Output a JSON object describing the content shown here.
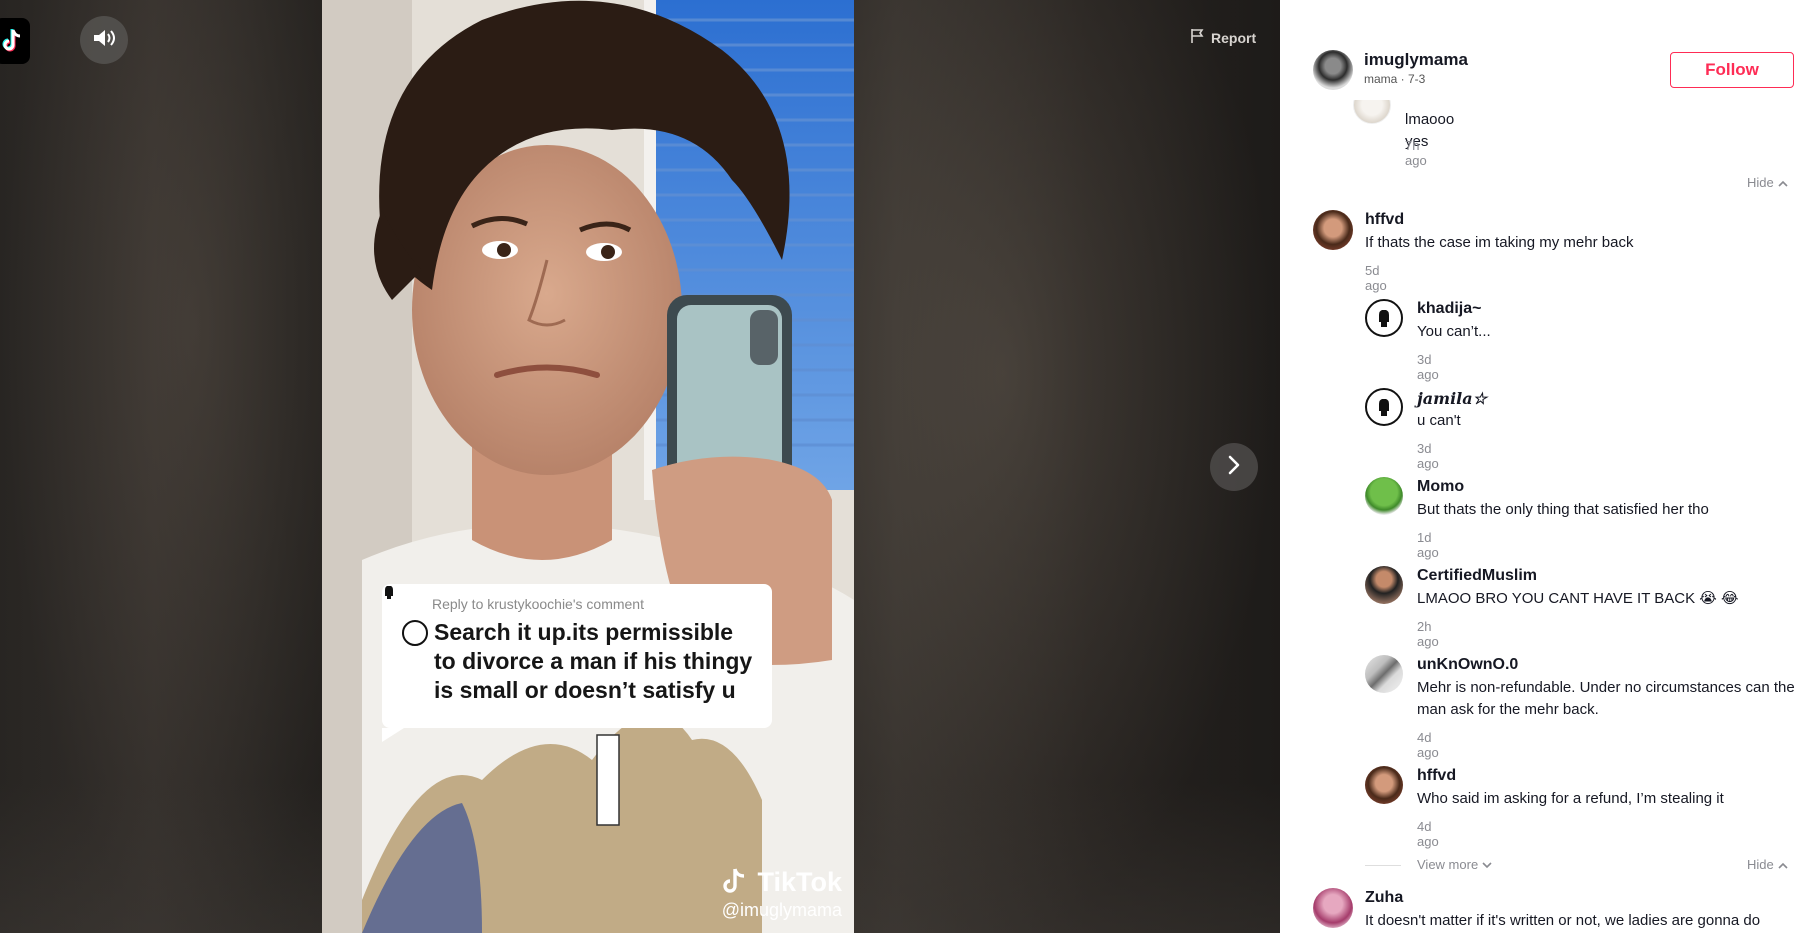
{
  "player": {
    "report_label": "Report",
    "sound_icon": "speaker-icon",
    "next_icon": "chevron-right-icon",
    "logo_icon": "tiktok-logo-icon"
  },
  "video": {
    "reply_context": "Reply to krustykoochie's comment",
    "reply_text": "Search it up.its permissible to divorce a man if his thingy is small or doesn’t satisfy u",
    "watermark_brand": "TikTok",
    "watermark_handle": "@imuglymama"
  },
  "post": {
    "author_name": "imuglymama",
    "author_sub": "mama · 7-3",
    "follow_label": "Follow"
  },
  "comments": {
    "partial_reply": {
      "text": "lmaooo yes",
      "time": "7h ago"
    },
    "hide_1": "Hide",
    "thread_1": {
      "name": "hffvd",
      "text": "If thats the case im taking my mehr back",
      "time": "5d ago",
      "replies": [
        {
          "name": "khadija~",
          "text": "You can’t...",
          "time": "3d ago"
        },
        {
          "name": "𝒋𝒂𝒎𝒊𝒍𝒂☆",
          "text": "u can't",
          "time": "3d ago"
        },
        {
          "name": "Momo",
          "text": "But thats the only thing that satisfied her tho",
          "time": "1d ago"
        },
        {
          "name": "CertifiedMuslim",
          "text": "LMAOO BRO YOU CANT HAVE IT BACK 😭 😂",
          "time": "2h ago"
        },
        {
          "name": "unKnOwnO.0",
          "text": "Mehr is non-refundable. Under no circumstances can the man ask for the mehr back.",
          "time": "4d ago"
        },
        {
          "name": "hffvd",
          "text": "Who said im asking for a refund, I’m stealing it",
          "time": "4d ago"
        }
      ],
      "view_more": "View more",
      "hide": "Hide"
    },
    "thread_2": {
      "name": "Zuha",
      "text": "It doesn't matter if it's written or not, we ladies are gonna do"
    }
  },
  "colors": {
    "accent": "#fe2c55",
    "muted": "#8a8b91",
    "text": "#161823"
  }
}
